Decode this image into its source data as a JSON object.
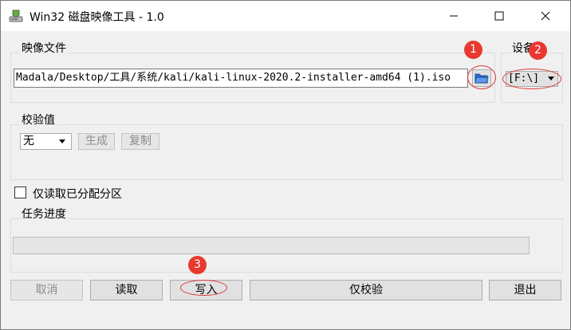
{
  "window": {
    "title": "Win32 磁盘映像工具 - 1.0",
    "app_icon": "disk-imager-icon",
    "controls": [
      "minimize-icon",
      "maximize-icon",
      "close-icon"
    ]
  },
  "image_file": {
    "group_label": "映像文件",
    "path_value": "Madala/Desktop/工具/系统/kali/kali-linux-2020.2-installer-amd64 (1).iso",
    "browse_icon": "folder-icon"
  },
  "device": {
    "group_label": "设备",
    "selected": "[F:\\]"
  },
  "hash": {
    "group_label": "校验值",
    "selected": "无",
    "generate_label": "生成",
    "copy_label": "复制"
  },
  "read_only": {
    "label": "仅读取已分配分区",
    "checked": false
  },
  "progress": {
    "group_label": "任务进度",
    "value": 0
  },
  "buttons": {
    "cancel": "取消",
    "read": "读取",
    "write": "写入",
    "verify": "仅校验",
    "exit": "退出"
  },
  "annotations": {
    "marker_1": "1",
    "marker_2": "2",
    "marker_3": "3",
    "color": "#e8382f"
  }
}
